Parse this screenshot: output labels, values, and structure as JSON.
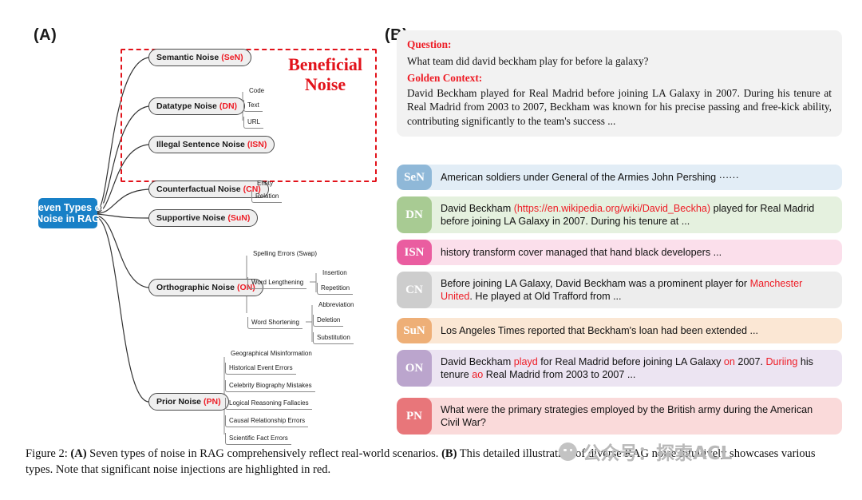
{
  "panels": {
    "a_label": "(A)",
    "b_label": "(B)"
  },
  "mindmap": {
    "root": {
      "line1": "Seven Types of",
      "line2": "Noise in RAG",
      "color": "#1880c7"
    },
    "beneficial_title": "Beneficial Noise",
    "beneficial_color": "#e2121a",
    "nodes": [
      {
        "name": "Semantic Noise",
        "abbr": "(SeN)"
      },
      {
        "name": "Datatype Noise",
        "abbr": "(DN)"
      },
      {
        "name": "Illegal Sentence Noise",
        "abbr": "(ISN)"
      },
      {
        "name": "Counterfactual Noise",
        "abbr": "(CN)"
      },
      {
        "name": "Supportive Noise",
        "abbr": "(SuN)"
      },
      {
        "name": "Orthographic Noise",
        "abbr": "(ON)"
      },
      {
        "name": "Prior Noise",
        "abbr": "(PN)"
      }
    ],
    "datatype_children": [
      "Code",
      "Text",
      "URL"
    ],
    "counterfactual_children": [
      "Entity",
      "Relation"
    ],
    "orthographic_children": [
      "Spelling Errors (Swap)",
      "Word Lengthening",
      "Word Shortening"
    ],
    "word_lengthening_children": [
      "Insertion",
      "Repetition"
    ],
    "word_shortening_children": [
      "Abbreviation",
      "Deletion",
      "Substitution"
    ],
    "prior_children": [
      "Geographical Misinformation",
      "Historical Event Errors",
      "Celebrity Biography Mistakes",
      "Logical Reasoning Fallacies",
      "Causal Relationship Errors",
      "Scientific Fact Errors"
    ]
  },
  "qa": {
    "question_label": "Question:",
    "question_text": "What team did david beckham play for before la galaxy?",
    "context_label": "Golden Context:",
    "context_text": "David Beckham played for Real Madrid before joining LA Galaxy in 2007. During his tenure at Real Madrid from 2003 to 2007, Beckham was known for his precise passing and free-kick ability, contributing significantly to the team's success ..."
  },
  "examples": [
    {
      "badge": "SeN",
      "badge_color": "#8fb8d8",
      "row_color": "#e2edf6",
      "segments": [
        {
          "t": "American soldiers under General of the Armies John Pershing ······",
          "hl": false
        }
      ]
    },
    {
      "badge": "DN",
      "badge_color": "#a8cb93",
      "row_color": "#e5f1df",
      "segments": [
        {
          "t": "David Beckham ",
          "hl": false
        },
        {
          "t": "(https://en.wikipedia.org/wiki/David_Beckha)",
          "hl": true
        },
        {
          "t": " played for Real Madrid before joining LA Galaxy in 2007. During his tenure at ...",
          "hl": false
        }
      ]
    },
    {
      "badge": "ISN",
      "badge_color": "#ea5da0",
      "row_color": "#fbdfeb",
      "segments": [
        {
          "t": "history transform cover managed that hand black developers ...",
          "hl": false
        }
      ]
    },
    {
      "badge": "CN",
      "badge_color": "#cdcdcd",
      "row_color": "#ededed",
      "segments": [
        {
          "t": "Before joining LA Galaxy, David Beckham was a prominent player for ",
          "hl": false
        },
        {
          "t": "Manchester United",
          "hl": true
        },
        {
          "t": ". He played at Old Trafford from ...",
          "hl": false
        }
      ]
    },
    {
      "badge": "SuN",
      "badge_color": "#eeaf77",
      "row_color": "#fbe7d4",
      "segments": [
        {
          "t": "Los Angeles Times reported that Beckham's loan had been extended ...",
          "hl": false
        }
      ]
    },
    {
      "badge": "ON",
      "badge_color": "#bba5cd",
      "row_color": "#ece4f2",
      "segments": [
        {
          "t": "David Beckham ",
          "hl": false
        },
        {
          "t": "playd",
          "hl": true
        },
        {
          "t": " for Real Madrid before joining LA Galaxy ",
          "hl": false
        },
        {
          "t": "on",
          "hl": true
        },
        {
          "t": " 2007. ",
          "hl": false
        },
        {
          "t": "Duriing",
          "hl": true
        },
        {
          "t": " his tenure ",
          "hl": false
        },
        {
          "t": "ao",
          "hl": true
        },
        {
          "t": " Real Madrid from 2003 to 2007 ...",
          "hl": false
        }
      ]
    },
    {
      "badge": "PN",
      "badge_color": "#e8767a",
      "row_color": "#fadada",
      "segments": [
        {
          "t": "What were the primary strategies employed by the British army during the American Civil War?",
          "hl": false
        }
      ]
    }
  ],
  "caption": {
    "prefix": "Figure 2: ",
    "a_tag": "(A)",
    "a_text": " Seven types of noise in RAG comprehensively reflect real-world scenarios. ",
    "b_tag": "(B)",
    "b_text": " This detailed illustration of diverse RAG noise intuitively showcases various types. Note that significant noise injections are highlighted in red."
  },
  "watermark": {
    "text": "公众号：探索ACL"
  }
}
